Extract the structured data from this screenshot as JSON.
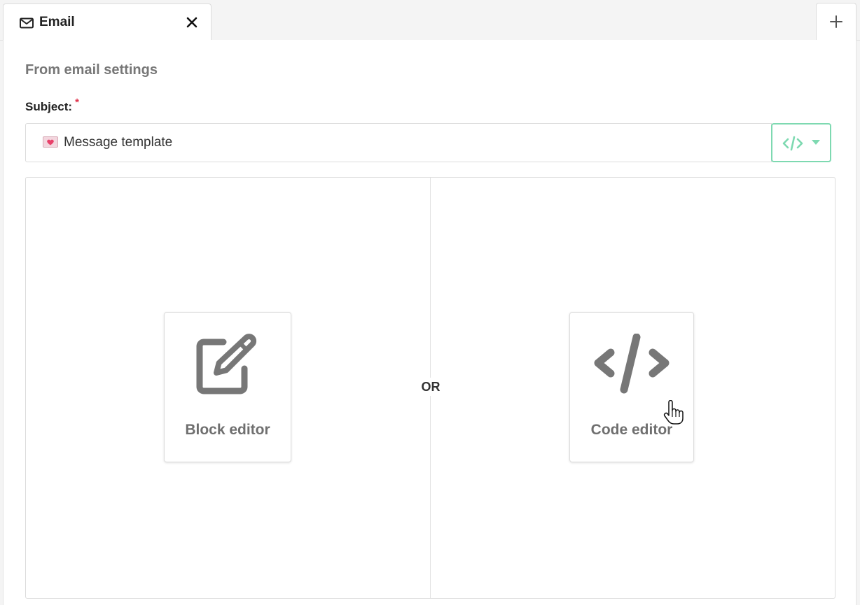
{
  "tabs": [
    {
      "label": "Email",
      "icon": "envelope-icon",
      "closable": true
    }
  ],
  "add_tab_icon": "plus-icon",
  "form": {
    "section_title": "From email settings",
    "subject_label": "Subject:",
    "required_marker": "*",
    "subject_value": "Message template",
    "subject_emoji": "love-letter-emoji",
    "code_button_icon": "code-icon"
  },
  "chooser": {
    "or_label": "OR",
    "options": [
      {
        "label": "Block editor",
        "icon": "pencil-square-icon"
      },
      {
        "label": "Code editor",
        "icon": "code-icon"
      }
    ]
  },
  "colors": {
    "accent": "#7ed9b1",
    "required": "#e0334b",
    "icon_gray": "#777777"
  }
}
